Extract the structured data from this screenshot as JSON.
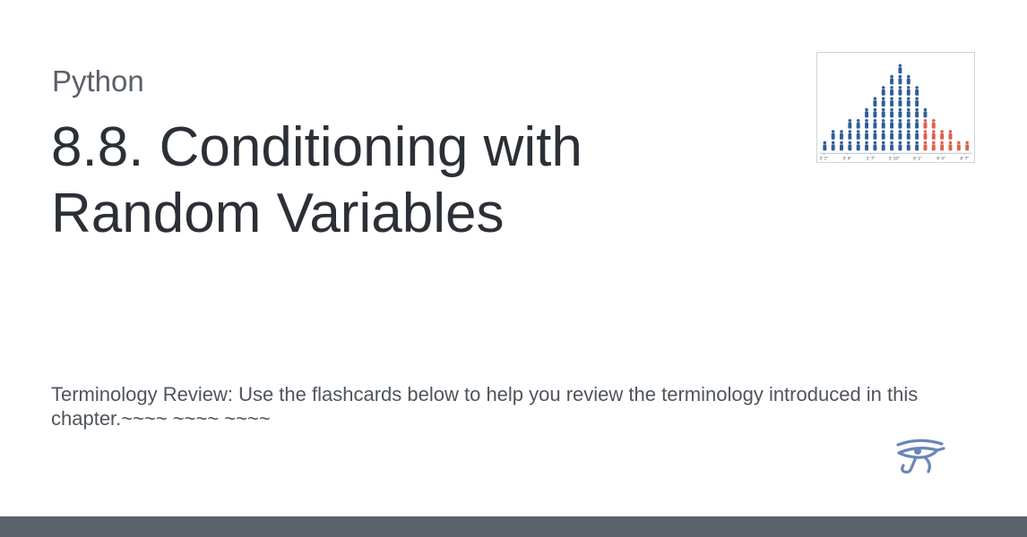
{
  "site": {
    "name": "Python"
  },
  "page": {
    "title": "8.8. Conditioning with Random Variables",
    "description": "Terminology Review: Use the flashcards below to help you review the terminology introduced in this chapter.~~~~ ~~~~ ~~~~"
  },
  "thumbnail": {
    "tick_labels": [
      "5' 1\"",
      "5' 4\"",
      "5' 7\"",
      "5' 10\"",
      "6' 1\"",
      "6' 4\"",
      "6' 7\""
    ],
    "colors": {
      "primary": "#2f5d9a",
      "highlight": "#e0604c"
    }
  },
  "logo": {
    "icon": "eye-of-horus-icon",
    "color": "#6a86b6"
  },
  "colors": {
    "title": "#2b3036",
    "site_name": "#5a6068",
    "description": "#4f555c",
    "footer": "#5b616b"
  }
}
